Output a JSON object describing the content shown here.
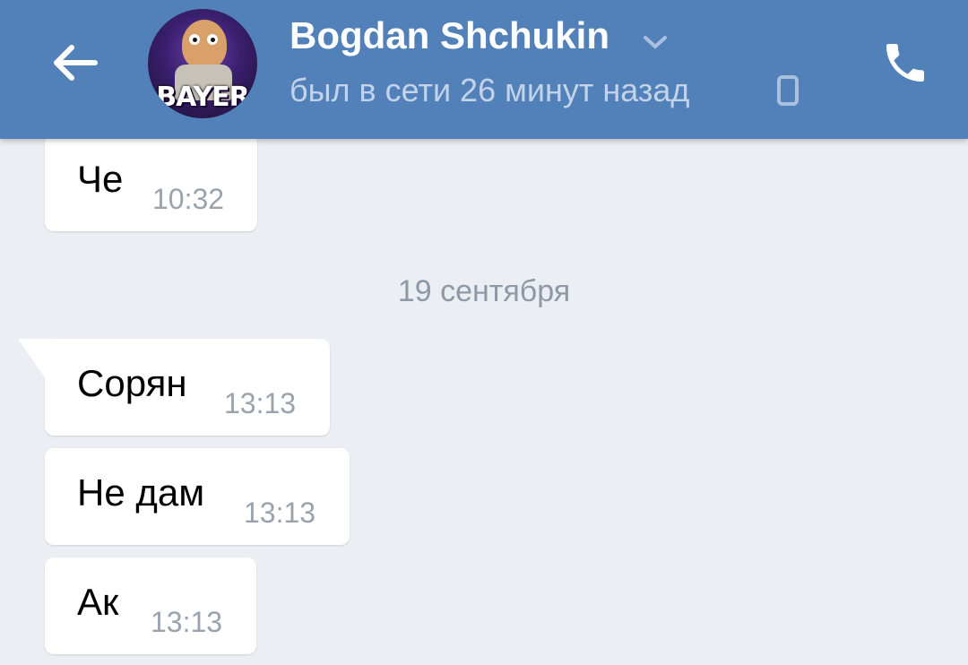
{
  "header": {
    "contact_name": "Bogdan Shchukin",
    "status": "был в сети 26 минут назад",
    "avatar_text": "BAYER",
    "back_icon": "arrow-left-icon",
    "call_icon": "phone-icon",
    "status_device_icon": "mobile-icon",
    "name_dropdown_icon": "chevron-down-icon"
  },
  "messages_before": [
    {
      "text": "Че",
      "time": "10:32"
    }
  ],
  "date_separator": "19 сентября",
  "messages_after": [
    {
      "text": "Сорян",
      "time": "13:13"
    },
    {
      "text": "Не дам",
      "time": "13:13"
    },
    {
      "text": "Ак",
      "time": "13:13"
    }
  ],
  "colors": {
    "header_bg": "#5181b8",
    "chat_bg": "#ebeef2",
    "bubble_bg": "#ffffff",
    "time_text": "#9aa3ad"
  }
}
